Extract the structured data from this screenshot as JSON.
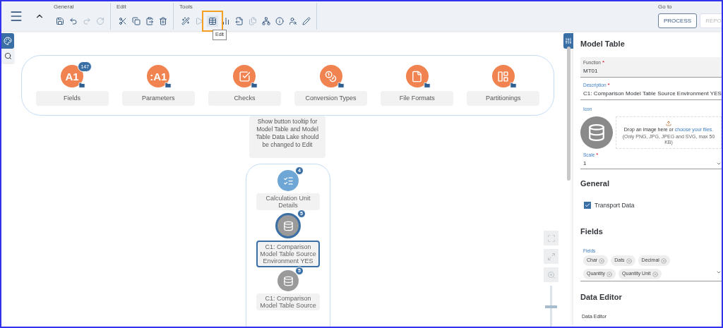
{
  "toolbar": {
    "groups": [
      {
        "label": "General",
        "buttons": [
          {
            "kind": "save",
            "disabled": false,
            "highlighted": false
          },
          {
            "kind": "undo",
            "disabled": false,
            "highlighted": false
          },
          {
            "kind": "redo",
            "disabled": true,
            "highlighted": false
          },
          {
            "kind": "refresh",
            "disabled": true,
            "highlighted": false
          }
        ]
      },
      {
        "label": "Edit",
        "buttons": [
          {
            "kind": "cut",
            "disabled": false,
            "highlighted": false
          },
          {
            "kind": "copy",
            "disabled": false,
            "highlighted": false
          },
          {
            "kind": "paste",
            "disabled": false,
            "highlighted": false
          },
          {
            "kind": "delete",
            "disabled": false,
            "highlighted": false
          }
        ]
      },
      {
        "label": "Tools",
        "buttons": [
          {
            "kind": "wand",
            "disabled": false,
            "highlighted": false
          },
          {
            "kind": "play",
            "disabled": true,
            "highlighted": false
          },
          {
            "kind": "table",
            "disabled": false,
            "highlighted": true
          },
          {
            "kind": "chart",
            "disabled": false,
            "highlighted": false
          },
          {
            "kind": "export",
            "disabled": false,
            "highlighted": false
          },
          {
            "kind": "duplicate",
            "disabled": true,
            "highlighted": false
          },
          {
            "kind": "hierarchy",
            "disabled": false,
            "highlighted": false
          },
          {
            "kind": "info",
            "disabled": false,
            "highlighted": false
          },
          {
            "kind": "usersearch",
            "disabled": false,
            "highlighted": false
          },
          {
            "kind": "pen",
            "disabled": false,
            "highlighted": false
          }
        ]
      }
    ],
    "tooltip": "Edit",
    "goto": {
      "label": "Go to",
      "buttons": [
        {
          "label": "PROCESS",
          "disabled": false
        },
        {
          "label": "REPO",
          "disabled": true
        }
      ]
    }
  },
  "canvas": {
    "top_group": [
      {
        "label": "Fields",
        "kind": "text",
        "icon_text": "A1",
        "badge": "147"
      },
      {
        "label": "Parameters",
        "kind": "text",
        "icon_text": ":A1"
      },
      {
        "label": "Checks",
        "kind": "check"
      },
      {
        "label": "Conversion Types",
        "kind": "conversion"
      },
      {
        "label": "File Formats",
        "kind": "file"
      },
      {
        "label": "Partitionings",
        "kind": "partition"
      }
    ],
    "note": "Show button tooltip for Model Table and Model Table Data Lake should be changed to Edit",
    "lower_group": [
      {
        "label": "Calculation Unit Details",
        "kind": "calc",
        "badge": "4",
        "selected": false
      },
      {
        "label": "C1: Comparison Model Table Source Environment YES",
        "kind": "database",
        "badge": "5",
        "selected": true
      },
      {
        "label": "C1: Comparison Model Table Source",
        "kind": "database",
        "badge": "5",
        "selected": false
      }
    ],
    "zoom_slider": {
      "level": 0.5
    }
  },
  "panel": {
    "title": "Model Table",
    "function": {
      "label": "Function",
      "required": "*",
      "value": "MT01"
    },
    "description": {
      "label": "Description",
      "required": "*",
      "value": "C1: Comparison Model Table Source Environment YES"
    },
    "icon_label": "Icon",
    "dropzone": {
      "text": "Drop an image here or ",
      "link": "choose your files.",
      "hint": "(Only PNG, JPG, JPEG and SVG, max 50 KB)"
    },
    "scale": {
      "label": "Scale",
      "required": "*",
      "value": "1"
    },
    "general": {
      "title": "General",
      "checkbox": {
        "label": "Transport Data",
        "checked": true
      }
    },
    "fields": {
      "title": "Fields",
      "label": "Fields",
      "tokens": [
        "Char",
        "Dats",
        "Decimal",
        "Quantity",
        "Quantity Unit"
      ]
    },
    "data_editor": {
      "title": "Data Editor",
      "label": "Data Editor"
    }
  }
}
